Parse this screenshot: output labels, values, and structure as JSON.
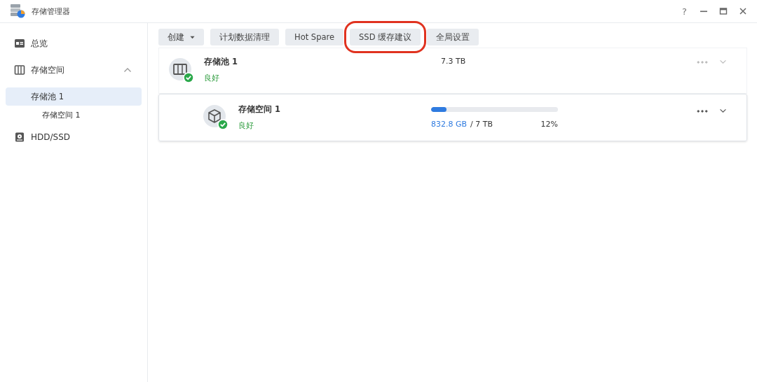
{
  "window": {
    "title": "存储管理器",
    "help": "?"
  },
  "sidebar": {
    "items": [
      {
        "kind": "overview",
        "label": "总览",
        "selected": false
      },
      {
        "kind": "storage",
        "label": "存储空间",
        "selected": false,
        "expanded": true,
        "children": [
          {
            "label": "存储池 1",
            "selected": true,
            "children": [
              {
                "label": "存储空间 1",
                "selected": false
              }
            ]
          }
        ]
      },
      {
        "kind": "disk",
        "label": "HDD/SSD",
        "selected": false
      }
    ]
  },
  "toolbar": [
    {
      "label": "创建",
      "dropdown": true,
      "highlighted": false
    },
    {
      "label": "计划数据清理",
      "dropdown": false,
      "highlighted": false
    },
    {
      "label": "Hot Spare",
      "dropdown": false,
      "highlighted": false
    },
    {
      "label": "SSD 缓存建议",
      "dropdown": false,
      "highlighted": true
    },
    {
      "label": "全局设置",
      "dropdown": false,
      "highlighted": false
    }
  ],
  "rows": [
    {
      "kind": "pool",
      "name": "存储池 1",
      "status": "良好",
      "size": "7.3 TB",
      "selected": false
    },
    {
      "kind": "volume",
      "name": "存储空间 1",
      "status": "良好",
      "used": "832.8 GB",
      "total": "/ 7 TB",
      "percent": "12%",
      "level": 0.12,
      "selected": true
    }
  ]
}
